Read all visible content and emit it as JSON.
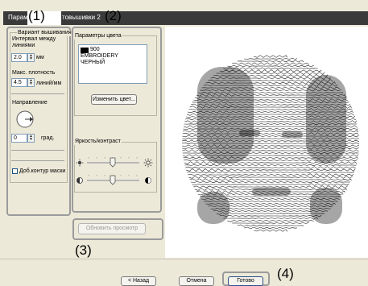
{
  "callouts": {
    "c1": "(1)",
    "c2": "(2)",
    "c3": "(3)",
    "c4": "(4)"
  },
  "titlebar": {
    "title_left": "Парам",
    "title_right": "товышивки 2"
  },
  "embroidery": {
    "group_title": "Вариант вышивания",
    "interval_label": "Интервал между линиями",
    "interval_value": "2.0",
    "interval_unit": "мм",
    "density_label": "Макс. плотность",
    "density_value": "4.5",
    "density_unit": "линий/мм",
    "direction_label": "Направление",
    "angle_value": "0",
    "angle_unit": "град.",
    "extra_contour_label": "Доб.контур маски"
  },
  "color": {
    "group_title": "Параметры цвета",
    "list_code": "900",
    "list_name": "EMBROIDERY",
    "list_color": "ЧЕРНЫЙ",
    "swatch_color": "#000000",
    "change_button": "Изменить цвет..."
  },
  "brightness": {
    "group_title": "Яркость/контраст",
    "brightness_level": 0.5,
    "contrast_level": 0.5
  },
  "refresh_button": "Обновить просмотр",
  "footer": {
    "back_button": "< Назад",
    "cancel_button": "Отмена",
    "finish_button": "Готово"
  }
}
